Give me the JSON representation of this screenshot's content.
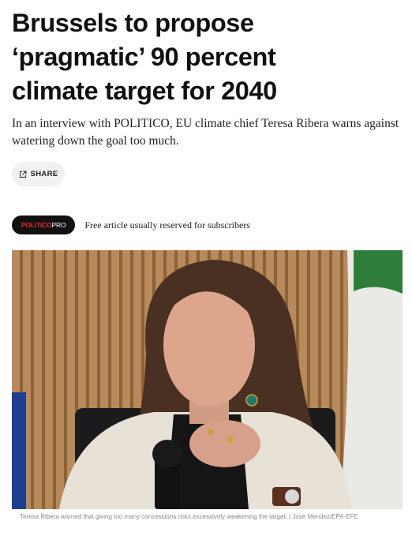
{
  "article": {
    "headline_lines": [
      "Brussels to propose",
      "‘pragmatic’ 90 percent",
      "climate target for 2040"
    ],
    "dek": "In an interview with POLITICO, EU climate chief Teresa Ribera warns against watering down the goal too much.",
    "share_label": "SHARE",
    "badge": {
      "part1": "POLITICO",
      "part2": "PRO"
    },
    "subscriber_note": "Free article usually reserved for subscribers",
    "caption": "Teresa Ribera warned that giving too many concessions risks excessively weakening the target. | Jose Mendez/EPA-EFE"
  },
  "icons": {
    "share": "share-external-icon"
  },
  "colors": {
    "badge_bg": "#111111",
    "badge_accent": "#e3262e",
    "share_bg": "#f1f1f1"
  }
}
